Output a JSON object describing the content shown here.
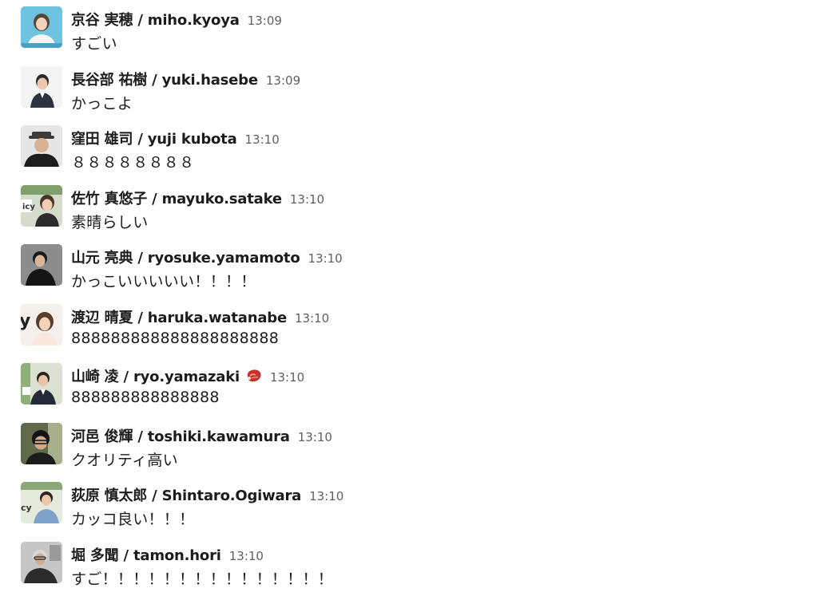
{
  "messages": [
    {
      "name": "京谷 実穂 / miho.kyoya",
      "time": "13:09",
      "text": "すごい",
      "avatar_bg": "#6ec3e0"
    },
    {
      "name": "長谷部 祐樹 / yuki.hasebe",
      "time": "13:09",
      "text": "かっこよ",
      "avatar_bg": "#f2f2f2"
    },
    {
      "name": "窪田 雄司 / yuji kubota",
      "time": "13:10",
      "text": "８８８８８８８８",
      "avatar_bg": "#e8e8e8"
    },
    {
      "name": "佐竹 真悠子 / mayuko.satake",
      "time": "13:10",
      "text": "素晴らしい",
      "avatar_bg": "#cfd8c4"
    },
    {
      "name": "山元 亮典 / ryosuke.yamamoto",
      "time": "13:10",
      "text": "かっこいいいいい！！！！",
      "avatar_bg": "#8a8a8a"
    },
    {
      "name": "渡辺 晴夏 / haruka.watanabe",
      "time": "13:10",
      "text": "888888888888888888888",
      "avatar_bg": "#f4f1ec"
    },
    {
      "name": "山崎 凌 / ryo.yamazaki",
      "time": "13:10",
      "text": "888888888888888",
      "avatar_bg": "#d8dccd",
      "status_emoji": "raw-meat-emoji"
    },
    {
      "name": "河邑 俊輝 / toshiki.kawamura",
      "time": "13:10",
      "text": "クオリティ高い",
      "avatar_bg": "#5e6a4a"
    },
    {
      "name": "荻原 慎太郎 / Shintaro.Ogiwara",
      "time": "13:10",
      "text": "カッコ良い！！！",
      "avatar_bg": "#e3ead9"
    },
    {
      "name": "堀 多聞 / tamon.hori",
      "time": "13:10",
      "text": "すご！！！！！！！！！！！！！！！",
      "avatar_bg": "#c9c9c9"
    }
  ],
  "colors": {
    "name": "#1d1c1d",
    "timestamp": "#616061",
    "background": "#ffffff"
  }
}
